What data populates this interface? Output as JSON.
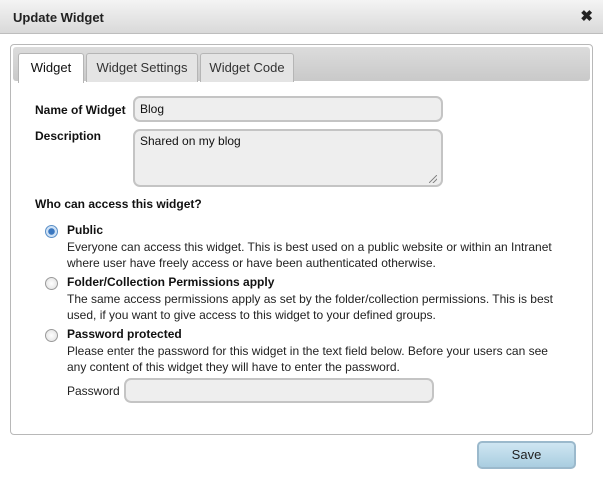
{
  "dialog": {
    "title": "Update Widget",
    "close_icon": "close-icon"
  },
  "tabs": [
    {
      "label": "Widget",
      "active": true
    },
    {
      "label": "Widget Settings",
      "active": false
    },
    {
      "label": "Widget Code",
      "active": false
    }
  ],
  "form": {
    "name_label": "Name of Widget",
    "name_value": "Blog",
    "description_label": "Description",
    "description_value": "Shared on my blog",
    "access_heading": "Who can access this widget?",
    "options": [
      {
        "title": "Public",
        "line1": "Everyone can access this widget. This is best used on a public website or within an Intranet",
        "line2": "where user have freely access or have been authenticated otherwise.",
        "selected": true
      },
      {
        "title": "Folder/Collection Permissions apply",
        "line1": "The same access permissions apply as set by the folder/collection permissions. This is best",
        "line2": "used, if you want to give access to this widget to your defined groups.",
        "selected": false
      },
      {
        "title": "Password protected",
        "line1": "Please enter the password for this widget in the text field below. Before your users can see",
        "line2": "any content of this widget they will have to enter the password.",
        "selected": false
      }
    ],
    "password_label": "Password",
    "password_value": ""
  },
  "buttons": {
    "save_label": "Save"
  },
  "colors": {
    "save_button": "#b8d9ea",
    "selected_radio": "#3a77c0",
    "titlebar": "#e2e2e2"
  }
}
